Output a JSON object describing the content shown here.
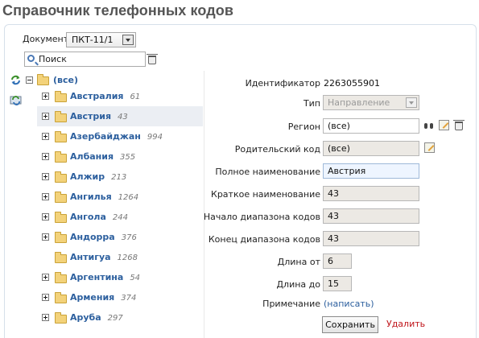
{
  "title": "Справочник телефонных кодов",
  "document": {
    "label": "Документ",
    "selected": "ПКТ-11/1"
  },
  "search": {
    "value": "Поиск"
  },
  "tree": {
    "root_label": "(все)",
    "items": [
      {
        "name": "Австралия",
        "count": "61",
        "has_children": true,
        "selected": false
      },
      {
        "name": "Австрия",
        "count": "43",
        "has_children": true,
        "selected": true
      },
      {
        "name": "Азербайджан",
        "count": "994",
        "has_children": true,
        "selected": false
      },
      {
        "name": "Албания",
        "count": "355",
        "has_children": true,
        "selected": false
      },
      {
        "name": "Алжир",
        "count": "213",
        "has_children": true,
        "selected": false
      },
      {
        "name": "Ангилья",
        "count": "1264",
        "has_children": true,
        "selected": false
      },
      {
        "name": "Ангола",
        "count": "244",
        "has_children": true,
        "selected": false
      },
      {
        "name": "Андорра",
        "count": "376",
        "has_children": true,
        "selected": false
      },
      {
        "name": "Антигуа",
        "count": "1268",
        "has_children": false,
        "selected": false
      },
      {
        "name": "Аргентина",
        "count": "54",
        "has_children": true,
        "selected": false
      },
      {
        "name": "Армения",
        "count": "374",
        "has_children": true,
        "selected": false
      },
      {
        "name": "Аруба",
        "count": "297",
        "has_children": true,
        "selected": false
      }
    ]
  },
  "form": {
    "id_label": "Идентификатор",
    "id_value": "2263055901",
    "type_label": "Тип",
    "type_value": "Направление",
    "region_label": "Регион",
    "region_value": "(все)",
    "parent_label": "Родительский код",
    "parent_value": "(все)",
    "fullname_label": "Полное наименование",
    "fullname_value": "Австрия",
    "shortname_label": "Краткое наименование",
    "shortname_value": "43",
    "range_start_label": "Начало диапазона кодов",
    "range_start_value": "43",
    "range_end_label": "Конец диапазона кодов",
    "range_end_value": "43",
    "len_from_label": "Длина от",
    "len_from_value": "6",
    "len_to_label": "Длина до",
    "len_to_value": "15",
    "note_label": "Примечание",
    "note_link": "(написать)",
    "save_label": "Сохранить",
    "delete_label": "Удалить"
  }
}
